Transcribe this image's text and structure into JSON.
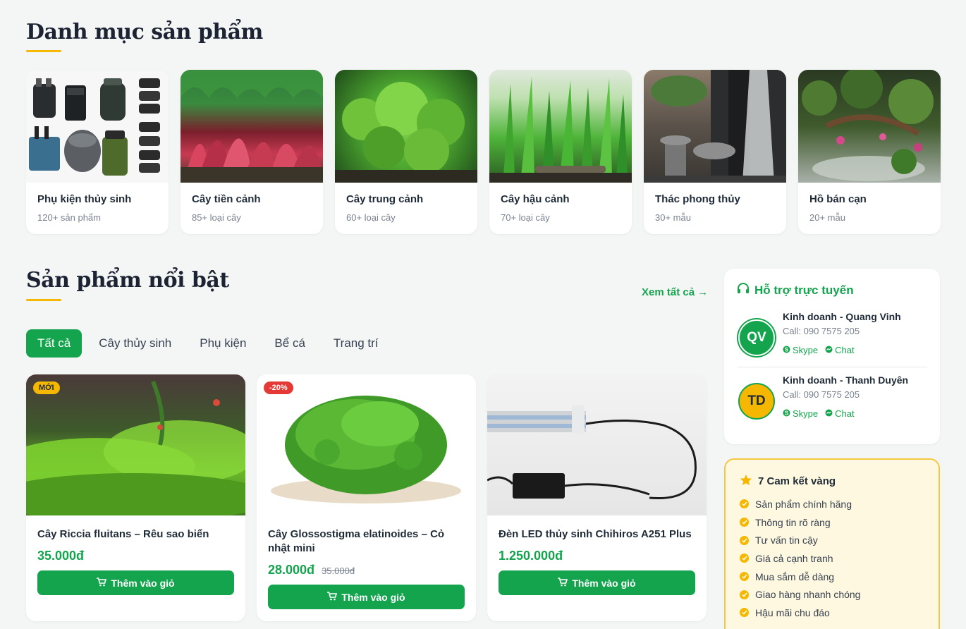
{
  "categories_section": {
    "title": "Danh mục sản phẩm",
    "items": [
      {
        "name": "Phụ kiện thủy sinh",
        "count": "120+ sản phẩm"
      },
      {
        "name": "Cây tiền cảnh",
        "count": "85+ loại cây"
      },
      {
        "name": "Cây trung cảnh",
        "count": "60+ loại cây"
      },
      {
        "name": "Cây hậu cảnh",
        "count": "70+ loại cây"
      },
      {
        "name": "Thác phong thủy",
        "count": "30+ mẫu"
      },
      {
        "name": "Hồ bán cạn",
        "count": "20+ mẫu"
      }
    ]
  },
  "featured": {
    "title": "Sản phẩm nổi bật",
    "see_all": "Xem tất cả →",
    "tabs": [
      "Tất cả",
      "Cây thủy sinh",
      "Phụ kiện",
      "Bể cá",
      "Trang trí"
    ],
    "active_tab": "Tất cả",
    "products": [
      {
        "badge": "MỚI",
        "name": "Cây Riccia fluitans – Rêu sao biển",
        "price": "35.000đ",
        "old_price": "",
        "button": "Thêm vào giỏ"
      },
      {
        "badge": "-20%",
        "name": "Cây Glossostigma elatinoides – Cỏ nhật mini",
        "price": "28.000đ",
        "old_price": "35.000đ",
        "button": "Thêm vào giỏ"
      },
      {
        "badge": "",
        "name": "Đèn LED thủy sinh Chihiros A251 Plus",
        "price": "1.250.000đ",
        "old_price": "",
        "button": "Thêm vào giỏ"
      }
    ]
  },
  "support": {
    "title": "Hỗ trợ trực tuyến",
    "agents": [
      {
        "initials": "QV",
        "name": "Kinh doanh - Quang Vinh",
        "phone": "Call: 090 7575 205",
        "skype": "Skype",
        "chat": "Chat"
      },
      {
        "initials": "TD",
        "name": "Kinh doanh - Thanh Duyên",
        "phone": "Call: 090 7575 205",
        "skype": "Skype",
        "chat": "Chat"
      }
    ]
  },
  "commitments": {
    "title": "7 Cam kết vàng",
    "items": [
      "Sản phẩm chính hãng",
      "Thông tin rõ ràng",
      "Tư vấn tin cậy",
      "Giá cả cạnh tranh",
      "Mua sắm dễ dàng",
      "Giao hàng nhanh chóng",
      "Hậu mãi chu đáo"
    ]
  },
  "colors": {
    "accent": "#14a44d",
    "highlight": "#f5b700",
    "sale": "#e53935"
  }
}
